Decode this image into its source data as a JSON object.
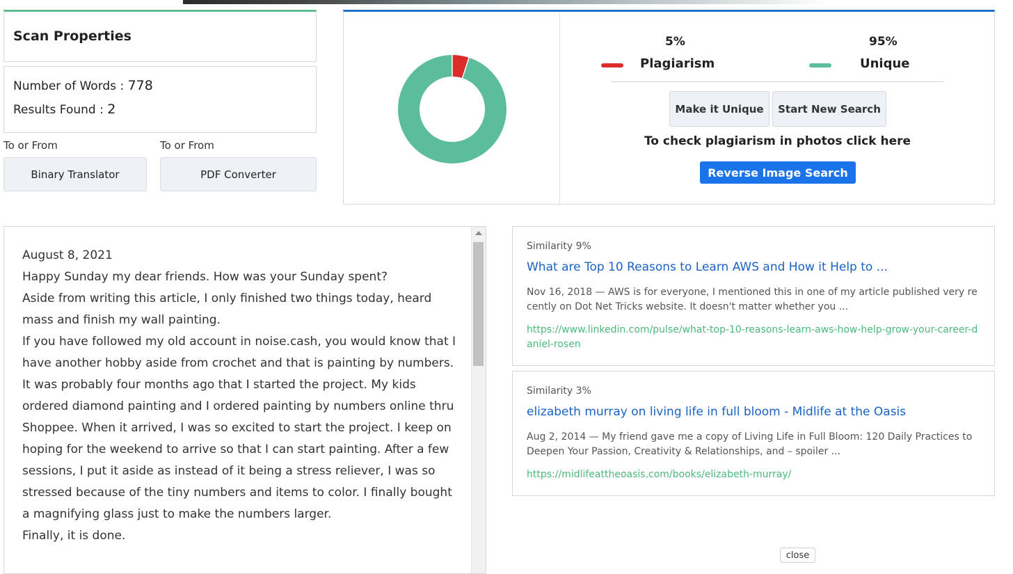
{
  "scan": {
    "title": "Scan Properties",
    "words_label": "Number of Words : ",
    "words_value": "778",
    "results_label": "Results Found : ",
    "results_value": "2"
  },
  "tools": [
    {
      "label": "To or From",
      "button": "Binary Translator"
    },
    {
      "label": "To or From",
      "button": "PDF Converter"
    }
  ],
  "result": {
    "plagiarism_pct": "5%",
    "plagiarism_label": "Plagiarism",
    "plagiarism_fraction": 0.05,
    "plagiarism_color": "#dc2b2b",
    "unique_pct": "95%",
    "unique_label": "Unique",
    "unique_fraction": 0.95,
    "unique_color": "#5bbd9b",
    "make_unique_button": "Make it Unique",
    "new_search_button": "Start New Search",
    "photo_text": "To check plagiarism in photos click here",
    "reverse_image_button": "Reverse Image Search"
  },
  "article": {
    "lines": [
      "August 8, 2021",
      "Happy Sunday my dear friends. How was your Sunday spent?",
      "Aside from writing this article, I only finished two things today, heard mass and finish my wall painting.",
      "If you have followed my old account in noise.cash, you would know that I have another hobby aside from crochet and that is painting by numbers.",
      "It was probably four months ago that I started the project. My kids ordered diamond painting and I ordered painting by numbers online thru Shoppee. When it arrived, I was so excited to start the project. I keep on hoping for the weekend to arrive so that I can start painting. After a few sessions, I put it aside as instead of it being a stress reliever, I was so stressed because of the tiny numbers and items to color. I finally bought a magnifying glass just to make the numbers larger.",
      "Finally, it is done."
    ]
  },
  "results": [
    {
      "similarity": "Similarity 9%",
      "title": "What are Top 10 Reasons to Learn AWS and How it Help to ...",
      "snippet": "Nov 16, 2018 — AWS is for everyone, I mentioned this in one of my article published very recently on Dot Net Tricks website. It doesn't matter whether you ...",
      "url": "https://www.linkedin.com/pulse/what-top-10-reasons-learn-aws-how-help-grow-your-career-daniel-rosen"
    },
    {
      "similarity": "Similarity 3%",
      "title": "elizabeth murray on living life in full bloom - Midlife at the Oasis",
      "snippet": "Aug 2, 2014 — My friend gave me a copy of Living Life in Full Bloom: 120 Daily Practices to Deepen Your Passion, Creativity & Relationships, and – spoiler ...",
      "url": "https://midlifeattheoasis.com/books/elizabeth-murray/"
    }
  ],
  "close_button": "close"
}
